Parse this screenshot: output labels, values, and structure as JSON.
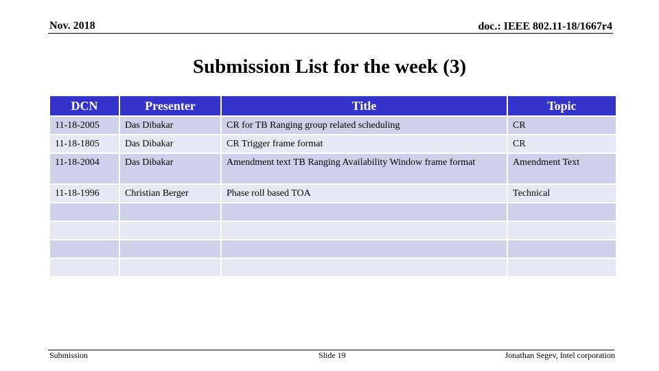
{
  "header": {
    "date": "Nov. 2018",
    "doc": "doc.: IEEE 802.11-18/1667r4"
  },
  "title": "Submission List for the week (3)",
  "table": {
    "columns": [
      "DCN",
      "Presenter",
      "Title",
      "Topic"
    ],
    "rows": [
      {
        "dcn": "11-18-2005",
        "presenter": "Das Dibakar",
        "title": "CR for TB Ranging group related scheduling",
        "topic": "CR"
      },
      {
        "dcn": "11-18-1805",
        "presenter": "Das Dibakar",
        "title": "CR Trigger frame format",
        "topic": "CR"
      },
      {
        "dcn": "11-18-2004",
        "presenter": "Das Dibakar",
        "title": "Amendment text TB Ranging Availability Window frame format",
        "topic": "Amendment Text"
      },
      {
        "dcn": "11-18-1996",
        "presenter": "Christian Berger",
        "title": "Phase roll based TOA",
        "topic": "Technical"
      },
      {
        "dcn": "",
        "presenter": "",
        "title": "",
        "topic": ""
      },
      {
        "dcn": "",
        "presenter": "",
        "title": "",
        "topic": ""
      },
      {
        "dcn": "",
        "presenter": "",
        "title": "",
        "topic": ""
      },
      {
        "dcn": "",
        "presenter": "",
        "title": "",
        "topic": ""
      }
    ]
  },
  "footer": {
    "left": "Submission",
    "center": "Slide 19",
    "right": "Jonathan Segev, Intel corporation"
  }
}
